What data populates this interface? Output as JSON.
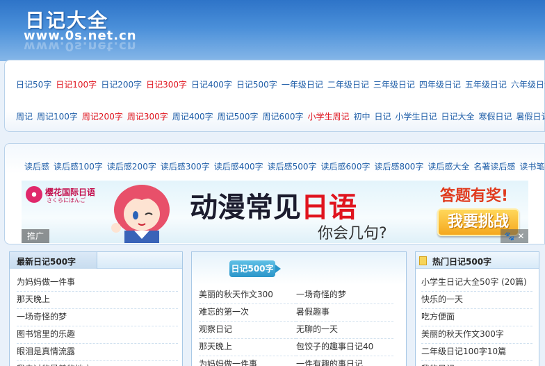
{
  "header": {
    "logo_cn": "日记大全",
    "logo_url": "www.0s.net.cn"
  },
  "nav": {
    "row1": [
      {
        "label": "日记50字",
        "color": "#1f5ea8"
      },
      {
        "label": "日记100字",
        "color": "#e0141e"
      },
      {
        "label": "日记200字",
        "color": "#1f5ea8"
      },
      {
        "label": "日记300字",
        "color": "#e0141e"
      },
      {
        "label": "日记400字",
        "color": "#1f5ea8"
      },
      {
        "label": "日记500字",
        "color": "#1f5ea8"
      },
      {
        "label": "一年级日记",
        "color": "#1f5ea8"
      },
      {
        "label": "二年级日记",
        "color": "#1f5ea8"
      },
      {
        "label": "三年级日记",
        "color": "#1f5ea8"
      },
      {
        "label": "四年级日记",
        "color": "#1f5ea8"
      },
      {
        "label": "五年级日记",
        "color": "#1f5ea8"
      },
      {
        "label": "六年级日记",
        "color": "#1f5ea8"
      }
    ],
    "row2": [
      {
        "label": "周记",
        "color": "#1f5ea8"
      },
      {
        "label": "周记100字",
        "color": "#1f5ea8"
      },
      {
        "label": "周记200字",
        "color": "#e0141e"
      },
      {
        "label": "周记300字",
        "color": "#e0141e"
      },
      {
        "label": "周记400字",
        "color": "#1f5ea8"
      },
      {
        "label": "周记500字",
        "color": "#1f5ea8"
      },
      {
        "label": "周记600字",
        "color": "#1f5ea8"
      },
      {
        "label": "小学生周记",
        "color": "#e0141e"
      },
      {
        "label": "初中",
        "color": "#1f5ea8"
      },
      {
        "label": "日记",
        "color": "#1f5ea8"
      },
      {
        "label": "小学生日记",
        "color": "#1f5ea8"
      },
      {
        "label": "日记大全",
        "color": "#1f5ea8"
      },
      {
        "label": "寒假日记",
        "color": "#1f5ea8"
      },
      {
        "label": "暑假日记",
        "color": "#1f5ea8"
      }
    ],
    "row3": [
      {
        "label": "读后感",
        "color": "#1f5ea8"
      },
      {
        "label": "读后感100字",
        "color": "#1f5ea8"
      },
      {
        "label": "读后感200字",
        "color": "#1f5ea8"
      },
      {
        "label": "读后感300字",
        "color": "#1f5ea8"
      },
      {
        "label": "读后感400字",
        "color": "#1f5ea8"
      },
      {
        "label": "读后感500字",
        "color": "#1f5ea8"
      },
      {
        "label": "读后感600字",
        "color": "#1f5ea8"
      },
      {
        "label": "读后感800字",
        "color": "#1f5ea8"
      },
      {
        "label": "读后感大全",
        "color": "#1f5ea8"
      },
      {
        "label": "名著读后感",
        "color": "#1f5ea8"
      },
      {
        "label": "读书笔记",
        "color": "#1f5ea8"
      }
    ]
  },
  "banner": {
    "brand": "樱花国际日语",
    "brand_sub": "さくらにほんご",
    "title_pre": "动漫常见",
    "title_hl": "日语",
    "subtitle": "你会几句?",
    "prize": "答题有奖!",
    "button": "我要挑战",
    "ad_label": "推广",
    "close": "✕"
  },
  "left_panel": {
    "title": "最新日记500字",
    "items": [
      "为妈妈做一件事",
      "那天晚上",
      "一场奇怪的梦",
      "图书馆里的乐趣",
      "眼泪是真情流露",
      "我去过的最美的地方"
    ]
  },
  "mid_panel": {
    "tab": "日记500字",
    "col1": [
      "美丽的秋天作文300",
      "难忘的第一次",
      "观察日记",
      "那天晚上",
      "为妈妈做一件事"
    ],
    "col2": [
      "一场奇怪的梦",
      "暑假趣事",
      "无聊的一天",
      "包饺子的趣事日记40",
      "一件有趣的事日记"
    ]
  },
  "right_panel": {
    "title": "热门日记500字",
    "items": [
      "小学生日记大全50字 (20篇)",
      "快乐的一天",
      "吃方便面",
      "美丽的秋天作文300字",
      "二年级日记100字10篇",
      "我的日记"
    ]
  }
}
